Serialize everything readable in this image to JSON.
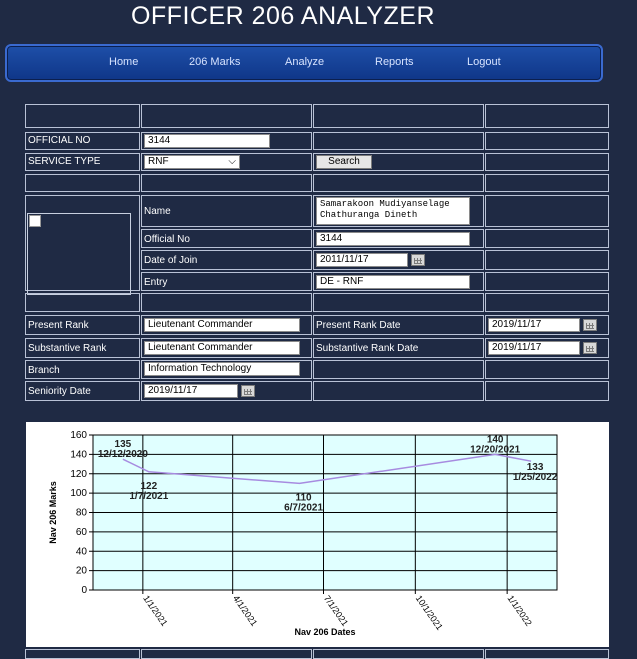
{
  "app": {
    "title": "OFFICER 206 ANALYZER"
  },
  "nav": [
    {
      "label": "Home"
    },
    {
      "label": "206 Marks"
    },
    {
      "label": "Analyze"
    },
    {
      "label": "Reports"
    },
    {
      "label": "Logout"
    }
  ],
  "form": {
    "official_no_label": "OFFICIAL NO",
    "official_no_value": "3144",
    "service_type_label": "SERVICE TYPE",
    "service_type_value": "RNF",
    "search_button": "Search"
  },
  "profile": {
    "name_label": "Name",
    "name_line1": "Samarakoon Mudiyanselage",
    "name_line2": "Chathuranga Dineth",
    "official_no_label": "Official No",
    "official_no_value": "3144",
    "date_of_join_label": "Date of Join",
    "date_of_join_value": "2011/11/17",
    "entry_label": "Entry",
    "entry_value": "DE - RNF",
    "present_rank_label": "Present Rank",
    "present_rank_value": "Lieutenant Commander",
    "present_rank_date_label": "Present Rank Date",
    "present_rank_date_value": "2019/11/17",
    "substantive_rank_label": "Substantive Rank",
    "substantive_rank_value": "Lieutenant Commander",
    "substantive_rank_date_label": "Substantive Rank Date",
    "substantive_rank_date_value": "2019/11/17",
    "branch_label": "Branch",
    "branch_value": "Information Technology",
    "seniority_date_label": "Seniority Date",
    "seniority_date_value": "2019/11/17"
  },
  "colors": {
    "background": "#1f2a44",
    "nav": "#1e4fa8",
    "plot_fill": "#e0ffff",
    "series_line": "#a78be0"
  },
  "chart_data": {
    "type": "line",
    "xlabel": "Nav 206 Dates",
    "ylabel": "Nav 206 Marks",
    "ylim": [
      0,
      160
    ],
    "yticks": [
      0,
      20,
      40,
      60,
      80,
      100,
      120,
      140,
      160
    ],
    "xticks": [
      "1/1/2021",
      "4/1/2021",
      "7/1/2021",
      "10/1/2021",
      "1/1/2022"
    ],
    "grid": true,
    "series": [
      {
        "points": [
          {
            "x": "12/12/2020",
            "y": 135
          },
          {
            "x": "1/7/2021",
            "y": 122
          },
          {
            "x": "6/7/2021",
            "y": 110
          },
          {
            "x": "12/20/2021",
            "y": 140
          },
          {
            "x": "1/25/2022",
            "y": 133
          }
        ]
      }
    ]
  }
}
